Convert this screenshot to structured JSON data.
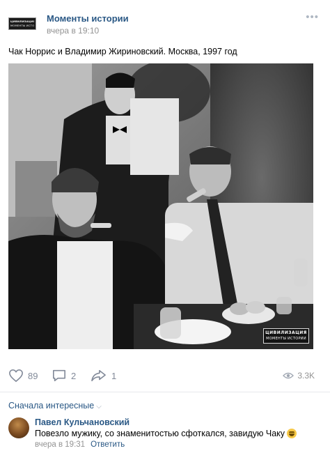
{
  "post": {
    "group_name": "Моменты истории",
    "time": "вчера в 19:10",
    "avatar_text": [
      "ЦИВИЛИЗАЦИЯ",
      "МОМЕНТЫ ИСТОРИИ"
    ],
    "text": "Чак Норрис и Владимир Жириновский. Москва, 1997 год",
    "photo_watermark": [
      "ЦИВИЛИЗАЦИЯ",
      "МОМЕНТЫ ИСТОРИИ"
    ],
    "more_icon": "more-dots-icon"
  },
  "actions": {
    "likes": "89",
    "comments": "2",
    "shares": "1",
    "views": "3.3K",
    "icons": [
      "heart-icon",
      "comment-icon",
      "share-icon",
      "eye-icon"
    ]
  },
  "comments_section": {
    "sort_label": "Сначала интересные",
    "items": [
      {
        "author": "Павел Кульчановский",
        "text": "Повезло мужику, со знаменитостью сфоткался, завидую Чаку",
        "emoji": "grinning-face-emoji",
        "time": "вчера в 19:31",
        "reply_label": "Ответить"
      }
    ]
  },
  "colors": {
    "link": "#2a5885",
    "muted": "#939393",
    "icon": "#828a99",
    "divider": "#e7e8ec"
  }
}
